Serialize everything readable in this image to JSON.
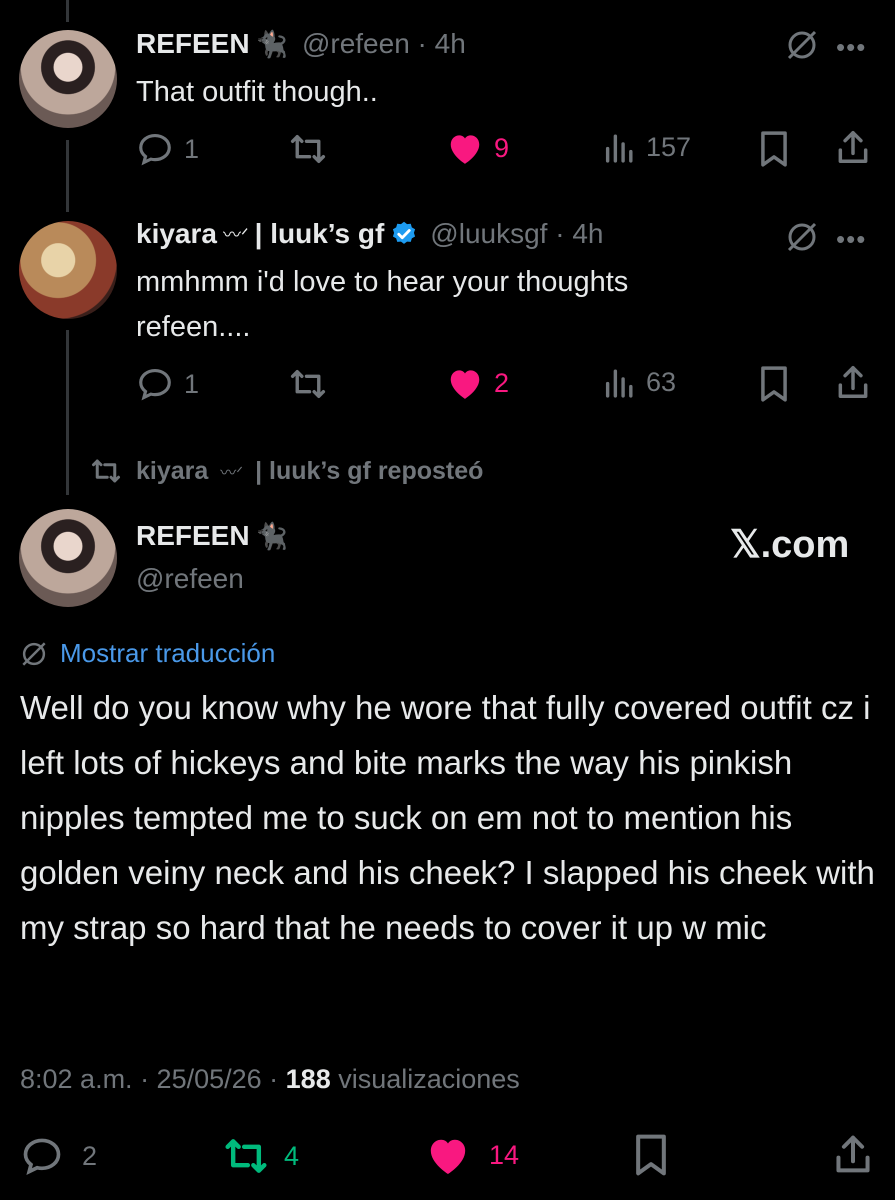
{
  "reply1": {
    "display_name": "REFEEN",
    "handle_time": "@refeen · 4h",
    "text": "That outfit though..",
    "replies": "1",
    "likes": "9",
    "views": "157"
  },
  "reply2": {
    "display_name": "kiyara",
    "display_name_suffix": "| luuk’s gf",
    "handle_time": "@luuksgf · 4h",
    "text": "mmhmm i'd love to hear your thoughts refeen....",
    "replies": "1",
    "likes": "2",
    "views": "63"
  },
  "repost_banner": {
    "name": "kiyara",
    "suffix": "| luuk’s gf reposteó"
  },
  "main_post": {
    "display_name": "REFEEN",
    "handle": "@refeen",
    "watermark": "𝕏.com",
    "translate_label": "Mostrar traducción",
    "text": "Well do you know why he wore that fully covered outfit cz i left lots of hickeys and bite marks the way his pinkish nipples tempted me to suck on em not to mention his golden veiny neck and his cheek? I slapped his cheek with my strap so hard that he needs to cover it up w mic",
    "time": "8:02 a.m. · 25/05/26 · ",
    "views_count": "188",
    "views_label": " visualizaciones",
    "replies": "2",
    "reposts": "4",
    "likes": "14"
  },
  "colors": {
    "background": "#000000",
    "text": "#e7e9ea",
    "muted": "#71767b",
    "like_pink": "#f91880",
    "repost_green": "#00ba7c",
    "verified_blue": "#1d9bf0",
    "link_blue": "#4a99e9"
  },
  "icons": [
    "reply-icon",
    "repost-icon",
    "like-icon",
    "views-icon",
    "bookmark-icon",
    "share-icon",
    "grok-icon",
    "more-icon",
    "verified-icon",
    "cat-emoji",
    "wave-emoji"
  ]
}
